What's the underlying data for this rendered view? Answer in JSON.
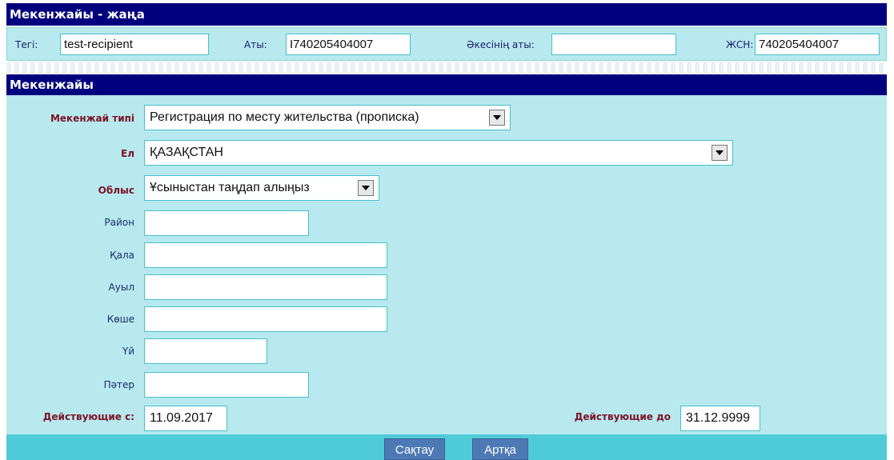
{
  "window": {
    "title": "Мекенжайы - жаңа"
  },
  "person": {
    "surname_label": "Тегі:",
    "surname_value": "test-recipient",
    "name_label": "Аты:",
    "name_value": "I740205404007",
    "patronymic_label": "Әкесінің аты:",
    "patronymic_value": "",
    "iin_label": "ЖСН:",
    "iin_value": "740205404007"
  },
  "section": {
    "title": "Мекенжайы"
  },
  "form": {
    "address_type_label": "Мекенжай типі",
    "address_type_value": "Регистрация по месту жительства (прописка)",
    "country_label": "Ел",
    "country_value": "ҚАЗАҚСТАН",
    "region_label": "Облыс",
    "region_value": "Ұсыныстан таңдап алыңыз",
    "district_label": "Район",
    "district_value": "",
    "city_label": "Қала",
    "city_value": "",
    "village_label": "Ауыл",
    "village_value": "",
    "street_label": "Көше",
    "street_value": "",
    "house_label": "Үй",
    "house_value": "",
    "flat_label": "Пәтер",
    "flat_value": "",
    "valid_from_label": "Действующие с:",
    "valid_from_value": "11.09.2017",
    "valid_to_label": "Действующие до",
    "valid_to_value": "31.12.9999"
  },
  "buttons": {
    "save": "Сақтау",
    "back": "Артқа"
  },
  "colors": {
    "header": "#00007f",
    "panel": "#b7e9ee",
    "required_label": "#7d1225",
    "button": "#4d79b5"
  },
  "icons": {
    "dropdown": "chevron-down-icon"
  }
}
